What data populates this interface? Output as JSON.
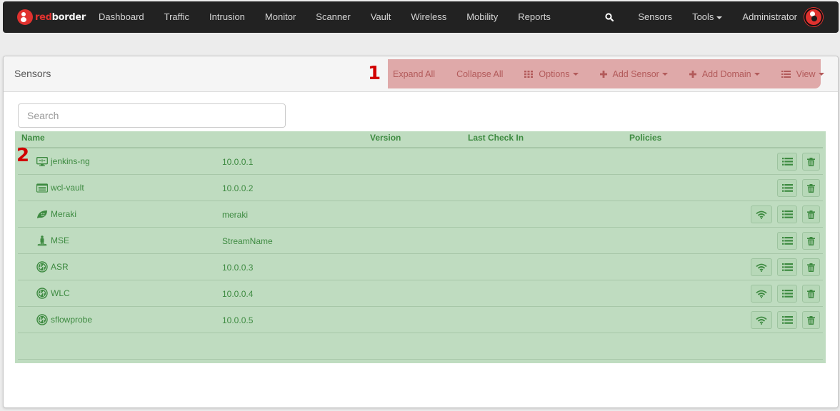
{
  "navbar": {
    "brand_red": "red",
    "brand_white": "border",
    "items": [
      "Dashboard",
      "Traffic",
      "Intrusion",
      "Monitor",
      "Scanner",
      "Vault",
      "Wireless",
      "Mobility",
      "Reports"
    ],
    "search_icon": "search-icon",
    "right_items": {
      "sensors": "Sensors",
      "tools": "Tools",
      "user": "Administrator"
    }
  },
  "panel": {
    "title": "Sensors",
    "annotation_1": "1",
    "annotation_2": "2",
    "toolbar": {
      "expand_all": "Expand All",
      "collapse_all": "Collapse All",
      "options": "Options",
      "add_sensor": "Add Sensor",
      "add_domain": "Add Domain",
      "view": "View"
    },
    "search": {
      "placeholder": "Search",
      "value": ""
    }
  },
  "table": {
    "columns": {
      "name": "Name",
      "version": "Version",
      "last_check_in": "Last Check In",
      "policies": "Policies"
    },
    "rows": [
      {
        "name": "jenkins-ng",
        "ip": "10.0.0.1",
        "icon": "monitor-network-icon",
        "version": "",
        "last_check_in": "",
        "policies": "",
        "wifi": false
      },
      {
        "name": "wcl-vault",
        "ip": "10.0.0.2",
        "icon": "vault-list-icon",
        "version": "",
        "last_check_in": "",
        "policies": "",
        "wifi": false
      },
      {
        "name": "Meraki",
        "ip": "meraki",
        "icon": "meraki-leaf-icon",
        "version": "",
        "last_check_in": "",
        "policies": "",
        "wifi": true
      },
      {
        "name": "MSE",
        "ip": "StreamName",
        "icon": "mobility-person-icon",
        "version": "",
        "last_check_in": "",
        "policies": "",
        "wifi": false
      },
      {
        "name": "ASR",
        "ip": "10.0.0.3",
        "icon": "flow-arrows-icon",
        "version": "",
        "last_check_in": "",
        "policies": "",
        "wifi": true
      },
      {
        "name": "WLC",
        "ip": "10.0.0.4",
        "icon": "flow-arrows-icon",
        "version": "",
        "last_check_in": "",
        "policies": "",
        "wifi": true
      },
      {
        "name": "sflowprobe",
        "ip": "10.0.0.5",
        "icon": "flow-arrows-icon",
        "version": "",
        "last_check_in": "",
        "policies": "",
        "wifi": true
      }
    ]
  },
  "colors": {
    "navbar_bg": "#222222",
    "brand_red": "#e0322f",
    "toolbar_highlight": "#dfa9a9",
    "toolbar_text": "#b25a5a",
    "table_highlight": "#bfdcc0",
    "table_text": "#3d8a40",
    "annotation": "#d10000"
  }
}
